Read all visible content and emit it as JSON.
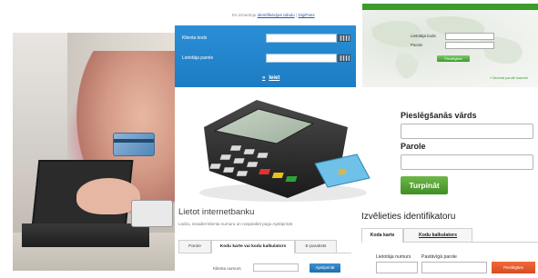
{
  "top_nav": {
    "prefix": "Es izmantoju",
    "link_table": "identifikācijas tabulu",
    "separator": "|",
    "link_digipass": "DigiPass"
  },
  "blue_login": {
    "client_code_label": "Klienta kods",
    "user_password_label": "Lietotāja parole",
    "submit_label": "Ieiet",
    "submit_arrow": "»",
    "background_color": "#1c7cc4"
  },
  "green_login": {
    "user_code_label": "Lietotāja kods",
    "password_label": "Parole",
    "button_label": "Pieslēgties",
    "note": "» Nezinat parolē tuanzini",
    "accent_color": "#3b9b2b"
  },
  "main_login": {
    "username_label": "Pieslēgšanās vārds",
    "password_label": "Parole",
    "continue_label": "Turpināt",
    "button_color": "#4a9a2d"
  },
  "internet_bank": {
    "title": "Lietot internetbanku",
    "subtitle": "Lūdzu, ievadiet klienta numuru un nospiediet pogu Apstiprināt",
    "tabs": [
      "Parole",
      "Kodu karte vai kodu kalkulators",
      "E-paraksts"
    ],
    "active_tab_index": 1,
    "field_label": "Klienta numurs",
    "confirm_label": "Apstiprināt"
  },
  "identifier": {
    "title": "Izvēlieties identifikatoru",
    "tabs": [
      "Koda karte",
      "Kodu kalkulators"
    ],
    "active_tab_index": 0,
    "user_number_label": "Lietotāja numurs",
    "permanent_password_label": "Pastāvīgā parole",
    "login_label": "Pieslēgties",
    "button_color": "#e25626"
  }
}
